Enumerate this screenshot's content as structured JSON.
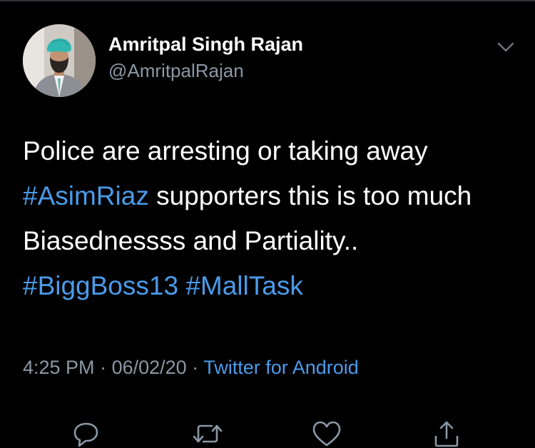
{
  "tweet": {
    "author": {
      "display_name": "Amritpal Singh Rajan",
      "handle": "@AmritpalRajan",
      "avatar_icon": "profile-photo"
    },
    "body": {
      "line1": "Police are arresting or taking away",
      "line2_hashtag": "#AsimRiaz",
      "line2_rest": " supporters this is too much",
      "line3": "Biasednessss and Partiality..",
      "line4_hashtag1": "#BiggBoss13",
      "line4_space": " ",
      "line4_hashtag2": "#MallTask"
    },
    "meta": {
      "time": "4:25 PM",
      "separator1": " · ",
      "date": "06/02/20",
      "separator2": " · ",
      "source": "Twitter for Android"
    },
    "actions": {
      "reply_icon": "reply-icon",
      "retweet_icon": "retweet-icon",
      "like_icon": "heart-icon",
      "share_icon": "share-icon"
    }
  },
  "colors": {
    "background": "#000000",
    "text": "#ffffff",
    "secondary": "#8b98a5",
    "accent": "#4b9bea"
  }
}
